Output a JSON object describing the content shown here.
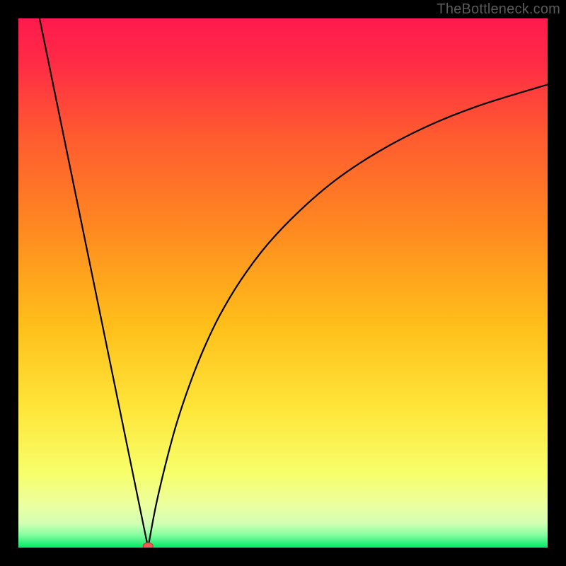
{
  "watermark": "TheBottleneck.com",
  "colors": {
    "frame": "#000000",
    "gradient_top": "#ff1a4d",
    "gradient_mid1": "#ff6a2a",
    "gradient_mid2": "#ffb020",
    "gradient_mid3": "#ffe63a",
    "gradient_mid4": "#fbff70",
    "gradient_bottom": "#00e86a",
    "curve": "#000000",
    "marker_fill": "#ec5a5a",
    "marker_stroke": "#b83b3b"
  },
  "chart_data": {
    "type": "line",
    "title": "",
    "xlabel": "",
    "ylabel": "",
    "x_norm_range": [
      0,
      1
    ],
    "y_norm_range": [
      0,
      1
    ],
    "dip_x_norm": 0.245,
    "marker": {
      "x_norm": 0.245,
      "y_norm": 0.0
    },
    "left_segment": {
      "start": {
        "x_norm": 0.04,
        "y_norm": 1.0
      },
      "end": {
        "x_norm": 0.245,
        "y_norm": 0.0
      }
    },
    "right_segment_samples": [
      {
        "x_norm": 0.245,
        "y_norm": 0.0
      },
      {
        "x_norm": 0.26,
        "y_norm": 0.08
      },
      {
        "x_norm": 0.28,
        "y_norm": 0.165
      },
      {
        "x_norm": 0.3,
        "y_norm": 0.238
      },
      {
        "x_norm": 0.325,
        "y_norm": 0.312
      },
      {
        "x_norm": 0.35,
        "y_norm": 0.375
      },
      {
        "x_norm": 0.38,
        "y_norm": 0.438
      },
      {
        "x_norm": 0.42,
        "y_norm": 0.505
      },
      {
        "x_norm": 0.47,
        "y_norm": 0.572
      },
      {
        "x_norm": 0.53,
        "y_norm": 0.635
      },
      {
        "x_norm": 0.6,
        "y_norm": 0.695
      },
      {
        "x_norm": 0.68,
        "y_norm": 0.748
      },
      {
        "x_norm": 0.77,
        "y_norm": 0.795
      },
      {
        "x_norm": 0.87,
        "y_norm": 0.835
      },
      {
        "x_norm": 1.0,
        "y_norm": 0.875
      }
    ],
    "gradient_stops": [
      {
        "offset": 0.0,
        "color": "#ff1a4d"
      },
      {
        "offset": 0.08,
        "color": "#ff2a46"
      },
      {
        "offset": 0.22,
        "color": "#ff5a30"
      },
      {
        "offset": 0.4,
        "color": "#ff8a20"
      },
      {
        "offset": 0.58,
        "color": "#ffbf1a"
      },
      {
        "offset": 0.74,
        "color": "#ffe63a"
      },
      {
        "offset": 0.86,
        "color": "#f6ff6a"
      },
      {
        "offset": 0.92,
        "color": "#ecffa0"
      },
      {
        "offset": 0.955,
        "color": "#d1ffb4"
      },
      {
        "offset": 0.975,
        "color": "#8affa0"
      },
      {
        "offset": 1.0,
        "color": "#00e86a"
      }
    ]
  }
}
